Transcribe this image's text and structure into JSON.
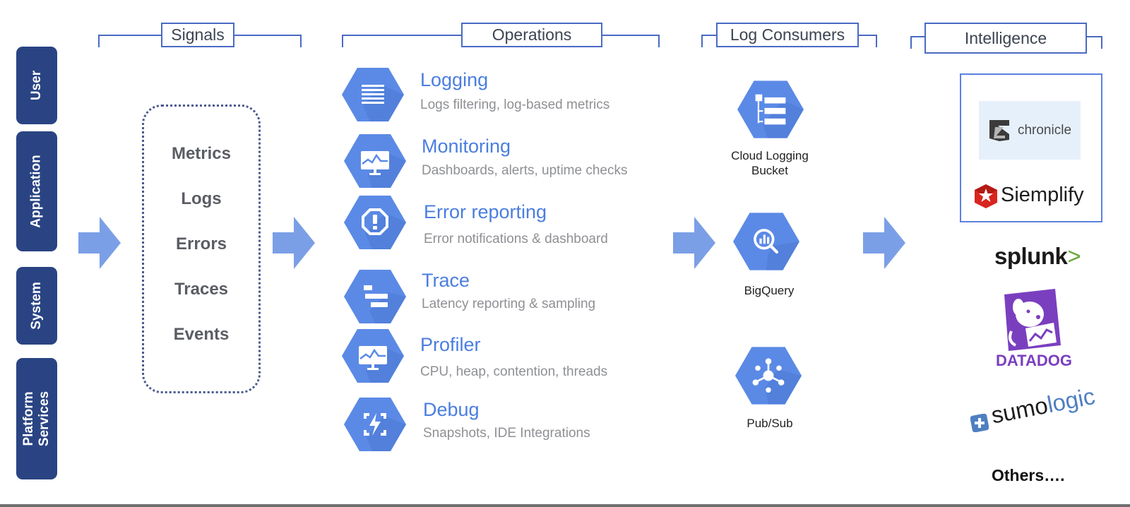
{
  "layers": [
    "User",
    "Application",
    "System",
    "Platform\nServices"
  ],
  "sections": {
    "signals": "Signals",
    "operations": "Operations",
    "log_consumers": "Log Consumers",
    "intelligence": "Intelligence"
  },
  "signals": [
    "Metrics",
    "Logs",
    "Errors",
    "Traces",
    "Events"
  ],
  "operations": [
    {
      "title": "Logging",
      "desc": "Logs filtering, log-based metrics",
      "icon": "logging-icon"
    },
    {
      "title": "Monitoring",
      "desc": "Dashboards, alerts, uptime checks",
      "icon": "monitoring-icon"
    },
    {
      "title": "Error reporting",
      "desc": "Error notifications & dashboard",
      "icon": "error-reporting-icon"
    },
    {
      "title": "Trace",
      "desc": "Latency reporting & sampling",
      "icon": "trace-icon"
    },
    {
      "title": "Profiler",
      "desc": "CPU, heap, contention, threads",
      "icon": "profiler-icon"
    },
    {
      "title": "Debug",
      "desc": "Snapshots, IDE Integrations",
      "icon": "debug-icon"
    }
  ],
  "consumers": [
    {
      "label": "Cloud Logging\nBucket",
      "icon": "cloud-logging-bucket-icon"
    },
    {
      "label": "BigQuery",
      "icon": "bigquery-icon"
    },
    {
      "label": "Pub/Sub",
      "icon": "pubsub-icon"
    }
  ],
  "intelligence": {
    "chronicle": "chronicle",
    "siemplify": "Siemplify",
    "splunk": "splunk",
    "splunk_chevron": ">",
    "datadog": "DATADOG",
    "sumo_a": "sumo",
    "sumo_b": "logic",
    "others": "Others…."
  },
  "colors": {
    "layer_bg": "#2a4483",
    "accent_blue": "#4a7ee0",
    "hex_blue": "#5b8ae6",
    "arrow_blue": "#7b9fe6",
    "bracket_blue": "#4a6bc4",
    "datadog_purple": "#7a3fbf",
    "siemplify_red": "#d8261f"
  }
}
